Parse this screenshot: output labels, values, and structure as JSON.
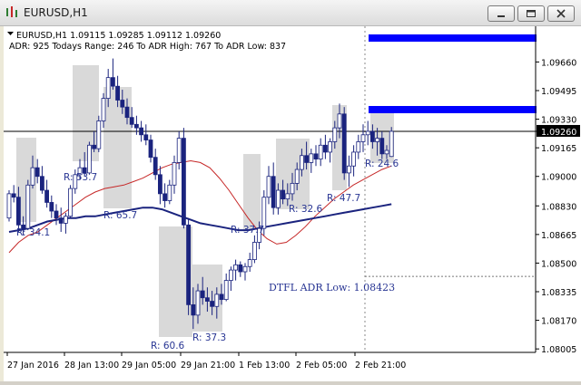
{
  "window": {
    "title": "EURUSD,H1",
    "buttons": [
      "minimize-icon",
      "restore-icon",
      "close-icon"
    ]
  },
  "header": {
    "line1": "EURUSD,H1  1.09115 1.09285 1.09112 1.09260",
    "line2": "ADR: 925  Todays Range: 246  To ADR High: 767  To ADR Low: 837"
  },
  "labels": {
    "adr_low": "DTFL ADR Low: 1.08423",
    "ranges": [
      "R: 34.1",
      "R: 53.7",
      "R: 65.7",
      "R: 60.6",
      "R: 37.3",
      "R: 37.7",
      "R: 32.6",
      "R: 47.7",
      "R: 24.6"
    ]
  },
  "colors": {
    "candle": "#1a237e",
    "box": "#d9d9d9",
    "ema_fast": "#c62828",
    "ema_slow": "#1a237e",
    "adr_band": "#0000ff",
    "current_price_tag": "#000000",
    "label_text": "#283593"
  },
  "chart_data": {
    "type": "candlestick",
    "symbol": "EURUSD",
    "timeframe": "H1",
    "y_ticks": [
      "1.09660",
      "1.09495",
      "1.09330",
      "1.09260",
      "1.09165",
      "1.09000",
      "1.08830",
      "1.08665",
      "1.08500",
      "1.08335",
      "1.08170",
      "1.08005"
    ],
    "x_ticks": [
      "27 Jan 2016",
      "28 Jan 13:00",
      "29 Jan 05:00",
      "29 Jan 21:00",
      "1 Feb 13:00",
      "2 Feb 05:00",
      "2 Feb 21:00"
    ],
    "ylim": [
      1.07985,
      1.09845
    ],
    "current_price": 1.0926,
    "adr_low_level": 1.08423,
    "ohlc": [
      [
        1.0876,
        1.0892,
        1.0874,
        1.089
      ],
      [
        1.089,
        1.0895,
        1.0885,
        1.0888
      ],
      [
        1.0888,
        1.0894,
        1.0868,
        1.0872
      ],
      [
        1.0872,
        1.0877,
        1.0866,
        1.087
      ],
      [
        1.087,
        1.0898,
        1.0869,
        1.0895
      ],
      [
        1.0895,
        1.0912,
        1.0893,
        1.0905
      ],
      [
        1.0905,
        1.091,
        1.0896,
        1.09
      ],
      [
        1.09,
        1.0906,
        1.089,
        1.0892
      ],
      [
        1.0892,
        1.0898,
        1.0882,
        1.0885
      ],
      [
        1.0885,
        1.0889,
        1.0876,
        1.088
      ],
      [
        1.088,
        1.0884,
        1.0872,
        1.0876
      ],
      [
        1.0876,
        1.0882,
        1.0868,
        1.0873
      ],
      [
        1.0873,
        1.0879,
        1.0867,
        1.0877
      ],
      [
        1.0877,
        1.0895,
        1.0876,
        1.0893
      ],
      [
        1.0893,
        1.0904,
        1.089,
        1.0901
      ],
      [
        1.0901,
        1.091,
        1.0898,
        1.0905
      ],
      [
        1.0905,
        1.0914,
        1.09,
        1.0902
      ],
      [
        1.0902,
        1.092,
        1.0901,
        1.0918
      ],
      [
        1.0918,
        1.0926,
        1.0914,
        1.0916
      ],
      [
        1.0916,
        1.0935,
        1.0914,
        1.0932
      ],
      [
        1.0932,
        1.0948,
        1.0928,
        1.0945
      ],
      [
        1.0945,
        1.0962,
        1.094,
        1.0957
      ],
      [
        1.0957,
        1.0968,
        1.095,
        1.0952
      ],
      [
        1.0952,
        1.0958,
        1.094,
        1.0944
      ],
      [
        1.0944,
        1.095,
        1.0936,
        1.094
      ],
      [
        1.094,
        1.0945,
        1.093,
        1.0934
      ],
      [
        1.0934,
        1.094,
        1.0928,
        1.093
      ],
      [
        1.093,
        1.0935,
        1.0924,
        1.0928
      ],
      [
        1.0928,
        1.0932,
        1.092,
        1.0924
      ],
      [
        1.0924,
        1.093,
        1.0918,
        1.0921
      ],
      [
        1.0921,
        1.0924,
        1.0908,
        1.0911
      ],
      [
        1.0911,
        1.0916,
        1.0898,
        1.0901
      ],
      [
        1.0901,
        1.0906,
        1.0884,
        1.089
      ],
      [
        1.089,
        1.0896,
        1.0882,
        1.0886
      ],
      [
        1.0886,
        1.0898,
        1.0884,
        1.0895
      ],
      [
        1.0895,
        1.0912,
        1.089,
        1.0908
      ],
      [
        1.0908,
        1.0926,
        1.0904,
        1.0922
      ],
      [
        1.0922,
        1.0928,
        1.087,
        1.0872
      ],
      [
        1.0872,
        1.0876,
        1.082,
        1.0826
      ],
      [
        1.0826,
        1.0836,
        1.0812,
        1.082
      ],
      [
        1.082,
        1.0838,
        1.0815,
        1.0834
      ],
      [
        1.0834,
        1.0842,
        1.0826,
        1.083
      ],
      [
        1.083,
        1.0836,
        1.0822,
        1.0828
      ],
      [
        1.0828,
        1.0834,
        1.082,
        1.0825
      ],
      [
        1.0825,
        1.0836,
        1.0818,
        1.0832
      ],
      [
        1.0832,
        1.0838,
        1.0826,
        1.0829
      ],
      [
        1.0829,
        1.0844,
        1.0828,
        1.084
      ],
      [
        1.084,
        1.0848,
        1.0834,
        1.0846
      ],
      [
        1.0846,
        1.0852,
        1.084,
        1.0849
      ],
      [
        1.0849,
        1.0851,
        1.0842,
        1.0845
      ],
      [
        1.0845,
        1.085,
        1.084,
        1.0848
      ],
      [
        1.0848,
        1.0856,
        1.0845,
        1.0852
      ],
      [
        1.0852,
        1.0866,
        1.085,
        1.0862
      ],
      [
        1.0862,
        1.0874,
        1.0858,
        1.087
      ],
      [
        1.087,
        1.0892,
        1.0866,
        1.0888
      ],
      [
        1.0888,
        1.0906,
        1.0884,
        1.09
      ],
      [
        1.09,
        1.0908,
        1.0878,
        1.0882
      ],
      [
        1.0882,
        1.0896,
        1.0878,
        1.0892
      ],
      [
        1.0892,
        1.0898,
        1.0884,
        1.0887
      ],
      [
        1.0887,
        1.0896,
        1.0883,
        1.089
      ],
      [
        1.089,
        1.0902,
        1.0886,
        1.0896
      ],
      [
        1.0896,
        1.0908,
        1.0892,
        1.0904
      ],
      [
        1.0904,
        1.0916,
        1.09,
        1.0912
      ],
      [
        1.0912,
        1.092,
        1.0904,
        1.0908
      ],
      [
        1.0908,
        1.0916,
        1.0902,
        1.0913
      ],
      [
        1.0913,
        1.0918,
        1.0906,
        1.091
      ],
      [
        1.091,
        1.0922,
        1.0906,
        1.0918
      ],
      [
        1.0918,
        1.0924,
        1.091,
        1.0914
      ],
      [
        1.0914,
        1.0922,
        1.0908,
        1.092
      ],
      [
        1.092,
        1.0932,
        1.0916,
        1.0928
      ],
      [
        1.0928,
        1.0942,
        1.0922,
        1.0936
      ],
      [
        1.0936,
        1.094,
        1.0898,
        1.0902
      ],
      [
        1.0902,
        1.0912,
        1.0894,
        1.0906
      ],
      [
        1.0906,
        1.0918,
        1.09,
        1.0914
      ],
      [
        1.0914,
        1.0924,
        1.091,
        1.092
      ],
      [
        1.092,
        1.093,
        1.0914,
        1.0924
      ],
      [
        1.0924,
        1.0932,
        1.0918,
        1.0926
      ],
      [
        1.0926,
        1.093,
        1.0916,
        1.092
      ],
      [
        1.092,
        1.0928,
        1.0912,
        1.0922
      ],
      [
        1.0922,
        1.0926,
        1.091,
        1.0913
      ],
      [
        1.0913,
        1.0918,
        1.091,
        1.0915
      ],
      [
        1.09115,
        1.09285,
        1.09112,
        1.0926
      ]
    ],
    "ema_fast": [
      1.0856,
      1.0862,
      1.0866,
      1.0868,
      1.0872,
      1.0876,
      1.088,
      1.0884,
      1.0888,
      1.0891,
      1.0893,
      1.0894,
      1.0895,
      1.0897,
      1.0899,
      1.0902,
      1.0905,
      1.0907,
      1.0908,
      1.0909,
      1.0908,
      1.0905,
      1.0899,
      1.0892,
      1.0884,
      1.0876,
      1.0869,
      1.0864,
      1.0861,
      1.0862,
      1.0866,
      1.0871,
      1.0877,
      1.0882,
      1.0887,
      1.0891,
      1.0895,
      1.0898,
      1.0901,
      1.0904,
      1.0906
    ],
    "ema_slow": [
      1.0868,
      1.0869,
      1.087,
      1.0872,
      1.0874,
      1.0875,
      1.0876,
      1.0876,
      1.0877,
      1.0877,
      1.0878,
      1.0879,
      1.088,
      1.0881,
      1.0882,
      1.0882,
      1.0881,
      1.0879,
      1.0877,
      1.0875,
      1.0873,
      1.0872,
      1.0871,
      1.087,
      1.0869,
      1.0869,
      1.087,
      1.0871,
      1.0872,
      1.0873,
      1.0874,
      1.0875,
      1.0876,
      1.0877,
      1.0878,
      1.0879,
      1.088,
      1.0881,
      1.0882,
      1.0883,
      1.0884
    ]
  }
}
